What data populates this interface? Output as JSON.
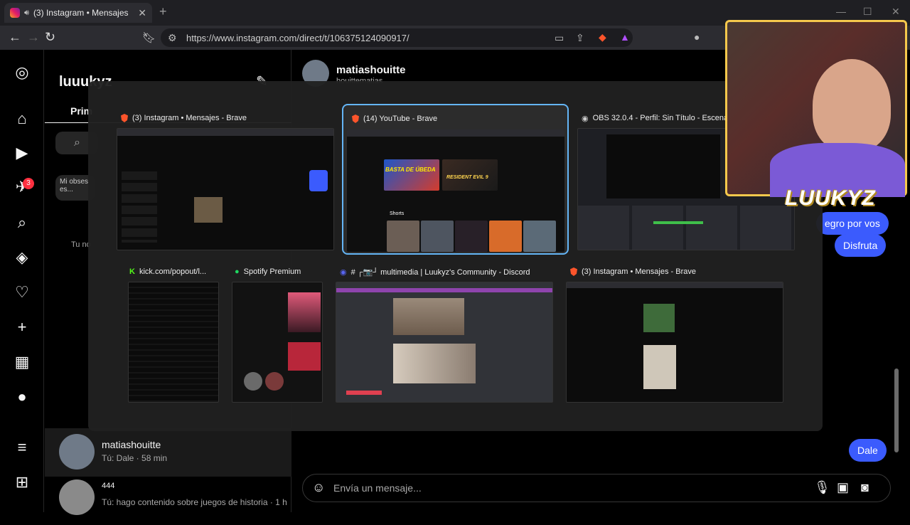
{
  "browser": {
    "tab_title": "(3) Instagram • Mensajes",
    "url": "https://www.instagram.com/direct/t/106375124090917/"
  },
  "instagram": {
    "username": "luuukyz",
    "tab_primary": "Prim",
    "note_text": "Mi obses es...",
    "your_note_label": "Tu no",
    "chat_header": {
      "name": "matiashouitte",
      "subtitle": "houittematias"
    },
    "conversations": [
      {
        "name": "matiashouitte",
        "preview": "Tú: Dale · 58 min",
        "active": true
      },
      {
        "name": "444",
        "preview": "Tú: hago contenido sobre juegos de historia · 1 h",
        "active": false
      }
    ],
    "messages": [
      {
        "text": "egro por vos"
      },
      {
        "text": "Disfruta"
      },
      {
        "text": "Dale"
      }
    ],
    "composer_placeholder": "Envía un mensaje...",
    "notification_count": "3"
  },
  "switcher": {
    "windows": [
      {
        "title": "(3) Instagram • Mensajes - Brave",
        "icon": "brave-icon",
        "selected": false
      },
      {
        "title": "(14) YouTube - Brave",
        "icon": "brave-icon",
        "selected": true
      },
      {
        "title": "OBS 32.0.4 - Perfil: Sin Título - Escenas:",
        "icon": "obs-icon",
        "selected": false
      },
      {
        "title": "kick.com/popout/l...",
        "icon": "kick-icon",
        "selected": false
      },
      {
        "title": "Spotify Premium",
        "icon": "spotify-icon",
        "selected": false
      },
      {
        "title": "# ┌📷┘ multimedia | Luukyz's Community - Discord",
        "icon": "discord-icon",
        "selected": false
      },
      {
        "title": "(3) Instagram • Mensajes - Brave",
        "icon": "brave-icon",
        "selected": false
      }
    ],
    "youtube_thumb_texts": [
      "BASTA DE ÚBEDA",
      "RESIDENT EVIL 9",
      "Shorts"
    ]
  },
  "webcam": {
    "logo": "LUUKYZ"
  },
  "colors": {
    "accent": "#3b5bfd",
    "selection": "#64b5f6",
    "webcam_border": "#f5c84c"
  }
}
